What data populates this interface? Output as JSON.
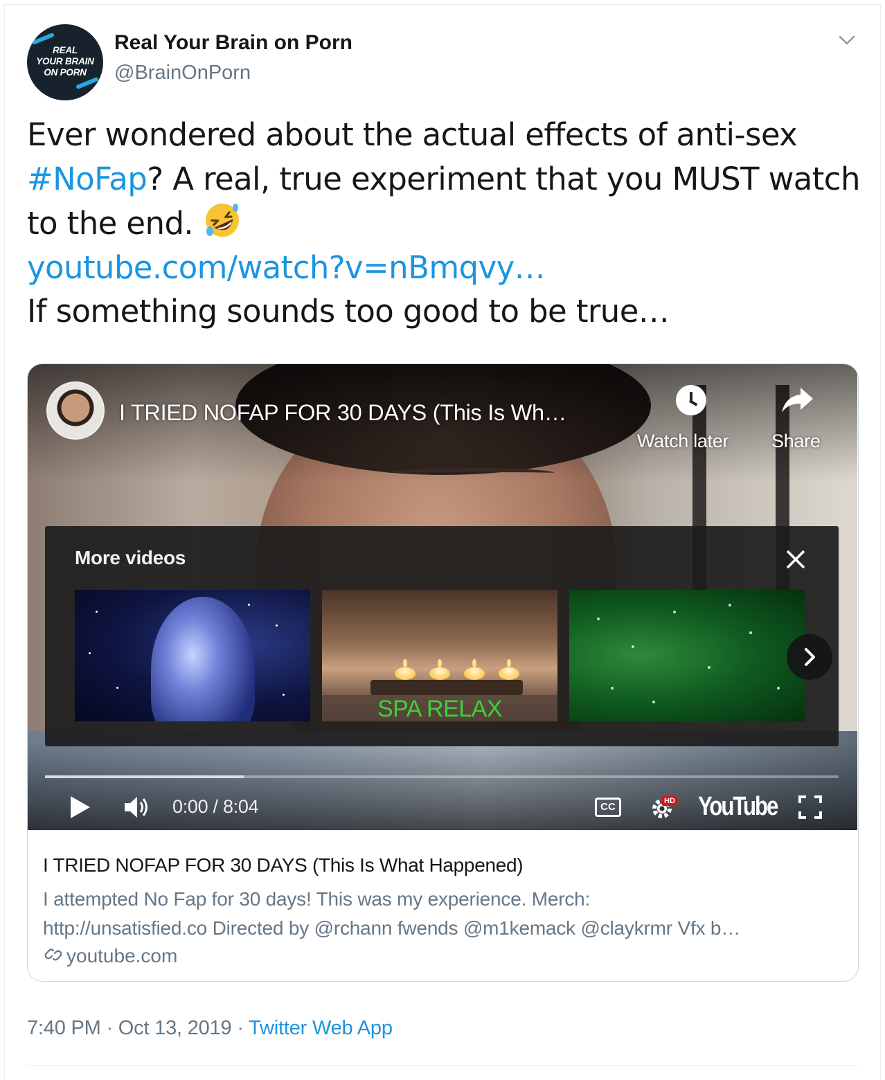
{
  "author": {
    "name": "Real Your Brain on Porn",
    "handle": "@BrainOnPorn",
    "avatar_lines": [
      "REAL",
      "YOUR BRAIN",
      "ON PORN"
    ]
  },
  "tweet": {
    "line1": "Ever wondered about the actual effects of anti-sex",
    "hashtag": "#NoFap",
    "line2_rest": "? A real, true experiment that you MUST watch",
    "line3": "to the end.",
    "emoji": "rolling-on-floor-laughing-emoji",
    "url": "youtube.com/watch?v=nBmqvy…",
    "line5": "If something sounds too good to be true…"
  },
  "player": {
    "video_title": "I TRIED NOFAP FOR 30 DAYS (This Is Wh…",
    "watch_later_label": "Watch later",
    "share_label": "Share",
    "more_videos_title": "More videos",
    "thumb2_caption": "SPA RELAX",
    "time": "0:00 / 8:04",
    "cc_label": "CC",
    "hd_label": "HD",
    "brand": "YouTube",
    "loaded_fraction": 0.25
  },
  "card": {
    "title": "I TRIED NOFAP FOR 30 DAYS (This Is What Happened)",
    "description_line1": "I attempted No Fap for 30 days! This was my experience. Merch:",
    "description_line2": "http://unsatisfied.co Directed by @rchann fwends @m1kemack @claykrmr Vfx b…",
    "domain": "youtube.com"
  },
  "footer": {
    "time": "7:40 PM",
    "date": "Oct 13, 2019",
    "separator": "·",
    "source": "Twitter Web App"
  },
  "colors": {
    "link": "#1b95e0",
    "secondary_text": "#657786",
    "border": "#ccd6dd",
    "spa_text": "#3cd13c",
    "hd_red": "#cc181e"
  }
}
